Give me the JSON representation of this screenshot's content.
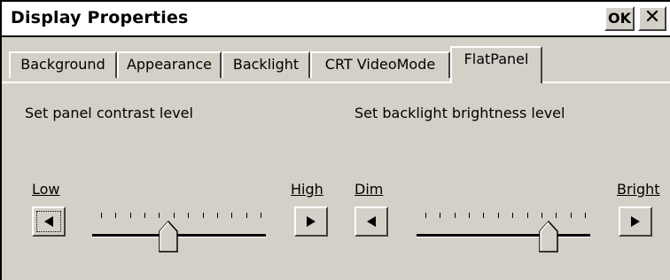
{
  "window": {
    "title": "Display Properties",
    "ok_label": "OK",
    "close_label": "✕"
  },
  "tabs": [
    {
      "label": "Background"
    },
    {
      "label": "Appearance"
    },
    {
      "label": "Backlight"
    },
    {
      "label": "CRT VideoMode"
    },
    {
      "label": "FlatPanel",
      "active": true
    }
  ],
  "contrast": {
    "heading": "Set panel contrast level",
    "low_label": "Low",
    "high_label": "High",
    "low_button_icon": "arrow-left-icon",
    "high_button_icon": "arrow-right-icon",
    "tick_count": 12,
    "value_fraction": 0.44
  },
  "brightness": {
    "heading": "Set backlight brightness level",
    "dim_label": "Dim",
    "bright_label": "Bright",
    "dim_button_icon": "arrow-left-icon",
    "bright_button_icon": "arrow-right-icon",
    "tick_count": 12,
    "value_fraction": 0.76
  }
}
